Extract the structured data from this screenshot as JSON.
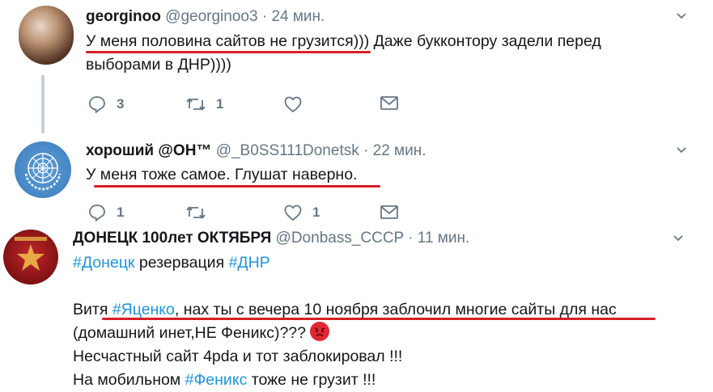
{
  "tweets": [
    {
      "name": "georginoo",
      "handle": "@georginoo3",
      "sep": "·",
      "time": "24 мин.",
      "text_line1": "У меня половина сайтов не грузится))) Даже букконтору задели перед",
      "text_line2": "выборами в ДНР))))",
      "reply_count": "3",
      "retweet_count": "1"
    },
    {
      "name": "хороший @OH™",
      "handle": "@_B0SS111Donetsk",
      "sep": "·",
      "time": "22 мин.",
      "text_line1": "У меня тоже самое. Глушат наверно.",
      "reply_count": "1",
      "like_count": "1"
    },
    {
      "name": "ДОНЕЦК 100лет ОКТЯБРЯ",
      "handle": "@Donbass_CCCP",
      "sep": "·",
      "time": "11 мин.",
      "line1_hash1": "#Донецк",
      "line1_text": " резервация ",
      "line1_hash2": "#ДНР",
      "line2_pre": "Витя ",
      "line2_hash": "#Яценко",
      "line2_post": ", нах ты с вечера 10 ноября заблочил многие сайты для нас",
      "line3": "(домашний инет,НЕ Феникс)??? ",
      "line4": "Несчастный сайт 4pda и тот заблокировал !!!",
      "line5_pre": "На мобильном ",
      "line5_hash": "#Феникс",
      "line5_post": " тоже не грузит !!!"
    }
  ],
  "colors": {
    "accent": "#1b95e0",
    "underline": "#d81f26",
    "muted": "#657786"
  }
}
